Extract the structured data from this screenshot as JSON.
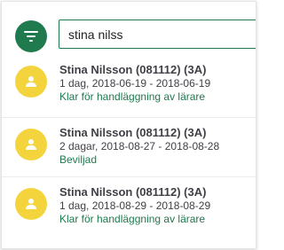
{
  "search": {
    "value": "stina nilss",
    "filter_icon": "filter-icon"
  },
  "colors": {
    "primary_green": "#1f7a4d",
    "avatar_yellow": "#f3d43c",
    "text_dark": "#3f3f46"
  },
  "results": [
    {
      "name": "Stina Nilsson (081112) (3A)",
      "dates": "1 dag, 2018-06-19 - 2018-06-19",
      "status": "Klar för handläggning av lärare",
      "icon": "person-icon"
    },
    {
      "name": "Stina Nilsson (081112) (3A)",
      "dates": "2 dagar, 2018-08-27 - 2018-08-28",
      "status": "Beviljad",
      "icon": "person-icon"
    },
    {
      "name": "Stina Nilsson (081112) (3A)",
      "dates": "1 dag, 2018-08-29 - 2018-08-29",
      "status": "Klar för handläggning av lärare",
      "icon": "person-icon"
    }
  ]
}
